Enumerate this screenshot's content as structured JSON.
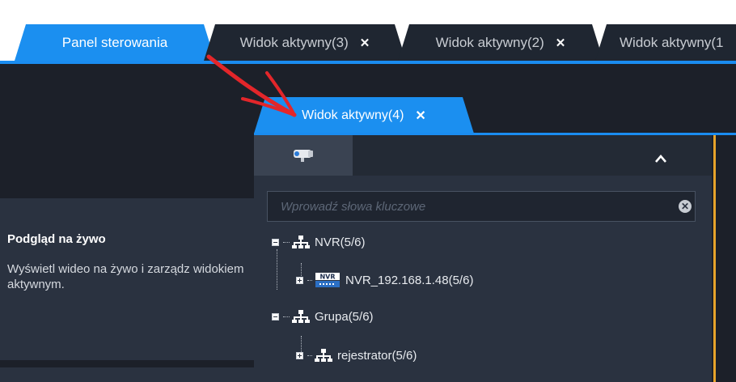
{
  "tabs": [
    {
      "label": "Panel sterowania",
      "active": true
    },
    {
      "label": "Widok aktywny(3)",
      "close": "✕"
    },
    {
      "label": "Widok aktywny(2)",
      "close": "✕"
    },
    {
      "label": "Widok aktywny(1"
    }
  ],
  "dragged_tab": {
    "label": "Widok aktywny(4)",
    "close": "✕"
  },
  "left_card": {
    "title": "Podgląd na żywo",
    "description": "Wyświetl wideo na żywo i zarządz widokiem aktywnym."
  },
  "panel": {
    "search_placeholder": "Wprowadź słowa kluczowe",
    "collapse_icon": "chevron-up-icon",
    "tree": [
      {
        "label": "NVR(5/6)",
        "icon": "network-icon"
      },
      {
        "label": "NVR_192.168.1.48(5/6)",
        "icon": "nvr-device-icon",
        "nvr_text": "NVR"
      },
      {
        "label": "Grupa(5/6)",
        "icon": "network-icon"
      },
      {
        "label": "rejestrator(5/6)",
        "icon": "network-icon"
      }
    ]
  },
  "colors": {
    "accent": "#1b8ff0",
    "background": "#1c2029",
    "panel": "#2a3240",
    "arrow": "#e3262a",
    "highlight_border": "#e7a32a"
  }
}
